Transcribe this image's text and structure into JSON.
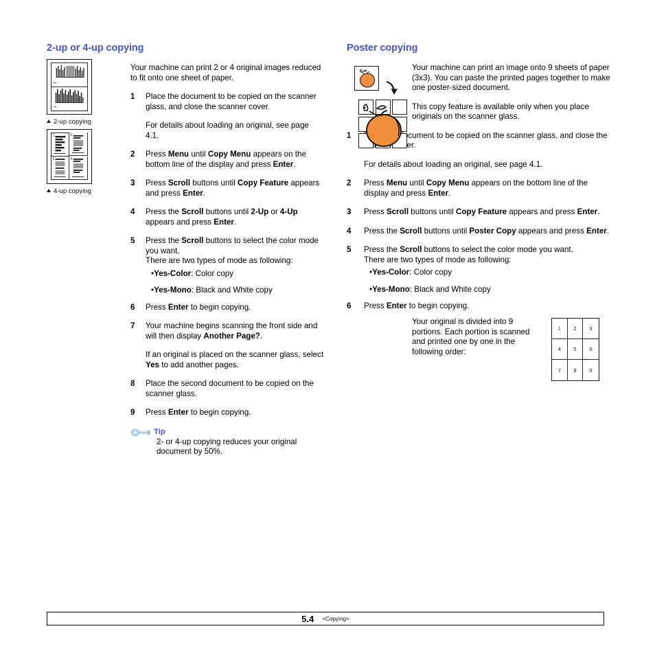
{
  "page": {
    "footer": {
      "page_number": "5.4",
      "section": "<Copying>"
    }
  },
  "left_column": {
    "title": "2-up or 4-up copying",
    "intro": "Your machine can print 2 or 4 original images reduced to fit onto one sheet of paper.",
    "figures": [
      {
        "caption": "2-up copying",
        "panels": [
          "2",
          "1"
        ]
      },
      {
        "caption": "4-up copying",
        "panels": [
          "1",
          "2",
          "3",
          "4"
        ]
      }
    ],
    "steps": [
      {
        "num": "1",
        "text": "Place the document to be copied on the scanner glass, and close the scanner cover.",
        "sub": "For details about loading an original, see page 4.1."
      },
      {
        "num": "2",
        "pre": "Press ",
        "b1": "Menu",
        "mid": " until ",
        "b2": "Copy Menu",
        "post": " appears on the bottom line of the display and press ",
        "b3": "Enter",
        "tail": "."
      },
      {
        "num": "3",
        "pre": "Press ",
        "b1": "Scroll",
        "mid": " buttons until ",
        "b2": "Copy Feature",
        "post": " appears and press ",
        "b3": "Enter",
        "tail": "."
      },
      {
        "num": "4",
        "pre": "Press the ",
        "b1": "Scroll",
        "mid": " buttons until ",
        "b2": "2-Up",
        "mid2": " or ",
        "b2b": "4-Up",
        "post": " appears and press ",
        "b3": "Enter",
        "tail": "."
      },
      {
        "num": "5",
        "pre": "Press the ",
        "b1": "Scroll",
        "post": " buttons to select the color mode you want.",
        "line2": "There are two types of mode as following:",
        "bullets": [
          {
            "label": "Yes-Color",
            "desc": ": Color copy"
          },
          {
            "label": "Yes-Mono",
            "desc": ": Black and White copy"
          }
        ]
      },
      {
        "num": "6",
        "pre": "Press ",
        "b1": "Enter",
        "post": " to begin copying."
      },
      {
        "num": "7",
        "pre": "Your machine begins scanning the front side and will then display ",
        "b1": "Another Page?",
        "post": ".",
        "sub_pre": "If an original is placed on the scanner glass, select ",
        "sub_b": "Yes",
        "sub_post": " to add another pages."
      },
      {
        "num": "8",
        "text": "Place the second document to be copied on the scanner glass."
      },
      {
        "num": "9",
        "pre": "Press ",
        "b1": "Enter",
        "post": " to begin copying."
      }
    ],
    "tip": {
      "heading": "Tip",
      "body": "2- or 4-up copying reduces your original document by 50%."
    }
  },
  "right_column": {
    "title": "Poster copying",
    "intro": "Your machine can print an image onto 9 sheets of paper (3x3). You can paste the printed pages together to make one poster-sized document.",
    "note": "This copy feature is available only when you place originals on the scanner glass.",
    "steps": [
      {
        "num": "1",
        "text": "Place the document to be copied on the scanner glass, and close the scanner cover.",
        "sub": "For details about loading an original, see page 4.1."
      },
      {
        "num": "2",
        "pre": "Press ",
        "b1": "Menu",
        "mid": " until ",
        "b2": "Copy Menu",
        "post": " appears on the bottom line of the display and press ",
        "b3": "Enter",
        "tail": "."
      },
      {
        "num": "3",
        "pre": "Press ",
        "b1": "Scroll",
        "mid": " buttons until ",
        "b2": "Copy Feature",
        "post": " appears and press ",
        "b3": "Enter",
        "tail": "."
      },
      {
        "num": "4",
        "pre": "Press the ",
        "b1": "Scroll",
        "mid": " buttons until ",
        "b2": "Poster Copy",
        "post": " appears and press ",
        "b3": "Enter",
        "tail": "."
      },
      {
        "num": "5",
        "pre": "Press the ",
        "b1": "Scroll",
        "post": " buttons to select the color mode you want.",
        "line2": "There are two types of mode as following:",
        "bullets": [
          {
            "label": "Yes-Color",
            "desc": ": Color copy"
          },
          {
            "label": "Yes-Mono",
            "desc": ": Black and White copy"
          }
        ]
      },
      {
        "num": "6",
        "pre": "Press ",
        "b1": "Enter",
        "post": " to begin copying."
      }
    ],
    "order_text": "Your original is divided into 9 portions. Each portion is scanned and printed one by one in the following order:",
    "order_grid": [
      "1",
      "2",
      "3",
      "4",
      "5",
      "6",
      "7",
      "8",
      "9"
    ]
  },
  "colors": {
    "heading": "#4a52cf",
    "tip_heading": "#4a52cf",
    "illustration_orange": "#ef8f3c",
    "text": "#000000"
  }
}
